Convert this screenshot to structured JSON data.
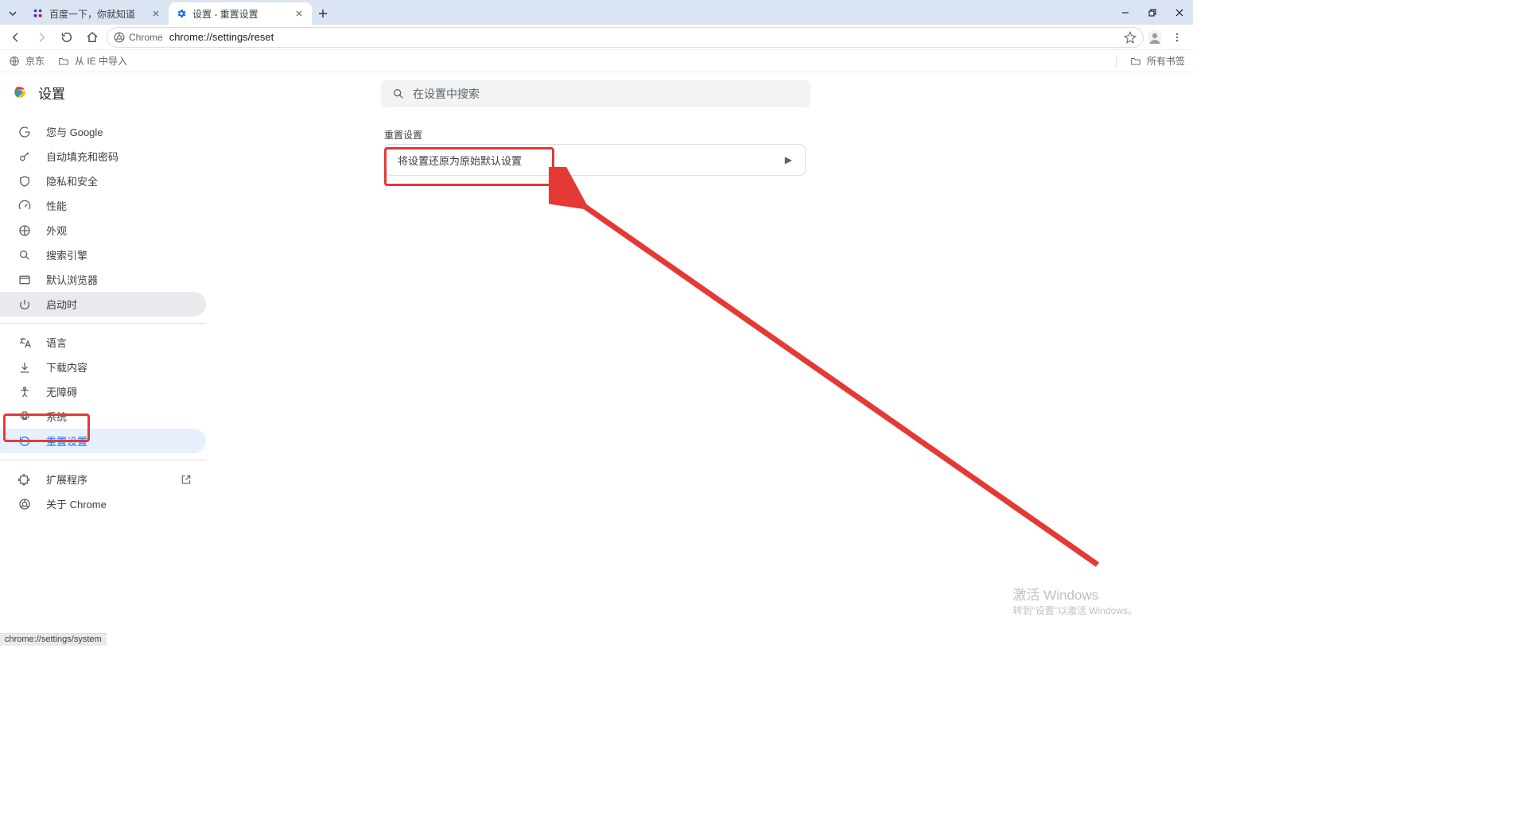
{
  "window": {
    "minimize_title": "Minimize",
    "maximize_title": "Restore",
    "close_title": "Close"
  },
  "tabs": [
    {
      "title": "百度一下，你就知道"
    },
    {
      "title": "设置 - 重置设置"
    }
  ],
  "toolbar": {
    "chip_label": "Chrome",
    "url": "chrome://settings/reset"
  },
  "bookmarks": {
    "items": [
      {
        "label": "京东"
      },
      {
        "label": "从 IE 中导入"
      }
    ],
    "all": "所有书签"
  },
  "settings": {
    "title": "设置",
    "search_placeholder": "在设置中搜索",
    "nav": [
      "您与 Google",
      "自动填充和密码",
      "隐私和安全",
      "性能",
      "外观",
      "搜索引擎",
      "默认浏览器",
      "启动时",
      "语言",
      "下载内容",
      "无障碍",
      "系统",
      "重置设置",
      "扩展程序",
      "关于 Chrome"
    ],
    "section_title": "重置设置",
    "card_label": "将设置还原为原始默认设置"
  },
  "watermark": {
    "line1": "激活 Windows",
    "line2": "转到\"设置\"以激活 Windows。"
  },
  "status": "chrome://settings/system"
}
